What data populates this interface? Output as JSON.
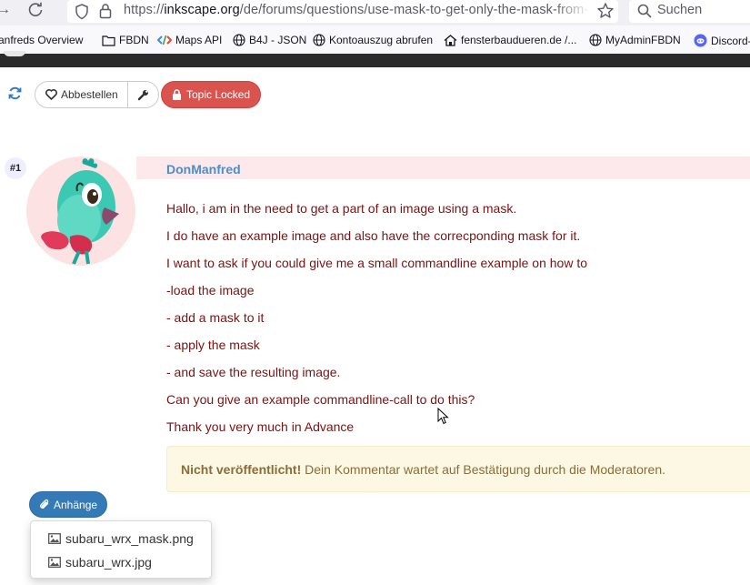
{
  "browser": {
    "url_prefix": "https://",
    "url_domain": "inkscape.org",
    "url_path": "/de/forums/questions/use-mask-to-get-only-the-mask-from-a-",
    "search_placeholder": "Suchen"
  },
  "bookmarks": [
    {
      "label": "anfreds Overview",
      "icon": "page-icon"
    },
    {
      "label": "FBDN",
      "icon": "folder-icon"
    },
    {
      "label": "Maps API",
      "icon": "code-icon"
    },
    {
      "label": "B4J - JSON",
      "icon": "globe-icon"
    },
    {
      "label": "Kontoauszug abrufen",
      "icon": "globe-icon"
    },
    {
      "label": "fensterbaudueren.de /...",
      "icon": "house-icon"
    },
    {
      "label": "MyAdminFBDN",
      "icon": "globe-icon"
    },
    {
      "label": "Discord-",
      "icon": "discord-icon"
    }
  ],
  "actions": {
    "unsubscribe_label": "Abbestellen",
    "locked_label": "Topic Locked"
  },
  "post": {
    "index": "#1",
    "author": "DonManfred",
    "lines": [
      "Hallo, i am in the need to get a part of an image using a mask.",
      "I do have an example image and also have the correcponding mask for it.",
      "I want to ask if you could give me a small commandline example on how to",
      "-load the image",
      "- add a mask to it",
      "- apply the mask",
      "- and save the resulting image.",
      "Can you give an example commandline-call to do this?",
      "Thank you very much in Advance"
    ],
    "alert_strong": "Nicht veröffentlicht!",
    "alert_text": " Dein Kommentar wartet auf Bestätigung durch die Moderatoren."
  },
  "attachments": {
    "button_label": "Anhänge",
    "files": [
      "subaru_wrx_mask.png",
      "subaru_wrx.jpg"
    ]
  },
  "colors": {
    "accent": "#337ab7",
    "danger": "#d9534f",
    "username": "#4f8dc9",
    "post_text": "#7a1212"
  }
}
